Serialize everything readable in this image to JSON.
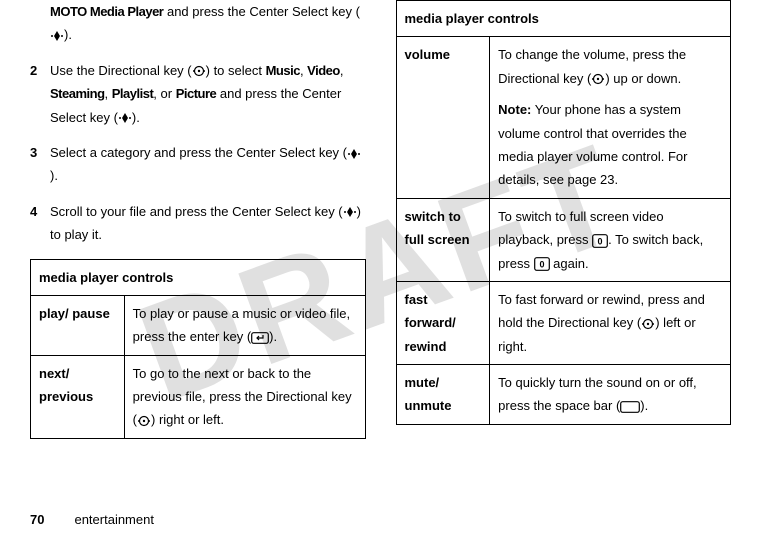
{
  "watermark": "DRAFT",
  "step1_prefix": "MOTO Media Player",
  "step1_suffix": " and press the Center Select key (",
  "step1_end": ").",
  "step2_num": "2",
  "step2_a": "Use the Directional key (",
  "step2_b": ") to select ",
  "step2_music": "Music",
  "step2_video": "Video",
  "step2_steaming": "Steaming",
  "step2_playlist": "Playlist",
  "step2_picture": "Picture",
  "step2_c": " and press the Center Select key (",
  "step2_end": ").",
  "sep_comma": ", ",
  "sep_or": ", or ",
  "step3_num": "3",
  "step3_a": "Select a category and press the Center Select key (",
  "step3_end": ").",
  "step4_num": "4",
  "step4_a": "Scroll to your file and press the Center Select key (",
  "step4_b": ") to play it.",
  "table_header": "media player controls",
  "row_play_label": "play/ pause",
  "row_play_a": "To play or pause a music or video file, press the enter key (",
  "row_play_b": ").",
  "row_next_label": "next/ previous",
  "row_next_a": "To go to the next or back to the previous file, press the Directional key (",
  "row_next_b": ") right or left.",
  "row_vol_label": "volume",
  "row_vol_a": "To change the volume, press the Directional key (",
  "row_vol_b": ") up or down.",
  "row_vol_note_label": "Note:",
  "row_vol_note": " Your phone has a system volume control that overrides the media player volume control. For details, see page 23.",
  "row_full_label": "switch to full screen",
  "row_full_a": "To switch to full screen video playback, press ",
  "row_full_b": ". To switch back, press ",
  "row_full_c": " again.",
  "key_zero": "0",
  "row_ff_label": "fast forward/ rewind",
  "row_ff_a": "To fast forward or rewind, press and hold the Directional key (",
  "row_ff_b": ") left or right.",
  "row_mute_label": "mute/ unmute",
  "row_mute_a": "To quickly turn the sound on or off, press the space bar (",
  "row_mute_b": ").",
  "page_number": "70",
  "page_section": "entertainment"
}
